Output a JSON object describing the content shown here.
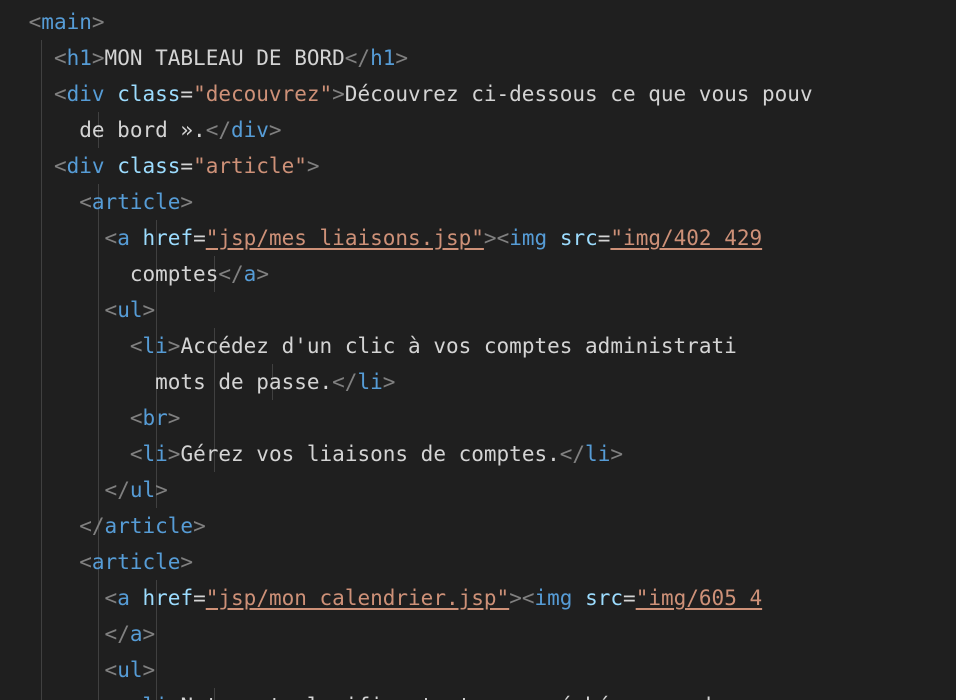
{
  "lines": [
    {
      "indent": 1,
      "tokens": [
        [
          "p",
          "<"
        ],
        [
          "tag",
          "main"
        ],
        [
          "p",
          ">"
        ]
      ]
    },
    {
      "indent": 3,
      "tokens": [
        [
          "p",
          "<"
        ],
        [
          "tag",
          "h1"
        ],
        [
          "p",
          ">"
        ],
        [
          "txt",
          "MON TABLEAU DE BORD"
        ],
        [
          "p",
          "</"
        ],
        [
          "tag",
          "h1"
        ],
        [
          "p",
          ">"
        ]
      ]
    },
    {
      "indent": 3,
      "tokens": [
        [
          "p",
          "<"
        ],
        [
          "tag",
          "div"
        ],
        [
          "txt",
          " "
        ],
        [
          "attr",
          "class"
        ],
        [
          "eq",
          "="
        ],
        [
          "str",
          "\"decouvrez\""
        ],
        [
          "p",
          ">"
        ],
        [
          "txt",
          "Découvrez ci-dessous ce que vous pouv"
        ]
      ]
    },
    {
      "indent": 5,
      "tokens": [
        [
          "txt",
          "de bord »."
        ],
        [
          "p",
          "</"
        ],
        [
          "tag",
          "div"
        ],
        [
          "p",
          ">"
        ]
      ]
    },
    {
      "indent": 3,
      "tokens": [
        [
          "p",
          "<"
        ],
        [
          "tag",
          "div"
        ],
        [
          "txt",
          " "
        ],
        [
          "attr",
          "class"
        ],
        [
          "eq",
          "="
        ],
        [
          "str",
          "\"article\""
        ],
        [
          "p",
          ">"
        ]
      ]
    },
    {
      "indent": 5,
      "tokens": [
        [
          "p",
          "<"
        ],
        [
          "tag",
          "article"
        ],
        [
          "p",
          ">"
        ]
      ]
    },
    {
      "indent": 7,
      "tokens": [
        [
          "p",
          "<"
        ],
        [
          "tag",
          "a"
        ],
        [
          "txt",
          " "
        ],
        [
          "attr",
          "href"
        ],
        [
          "eq",
          "="
        ],
        [
          "str link",
          "\"jsp/mes_liaisons.jsp\""
        ],
        [
          "p",
          ">"
        ],
        [
          "p",
          "<"
        ],
        [
          "tag",
          "img"
        ],
        [
          "txt",
          " "
        ],
        [
          "attr",
          "src"
        ],
        [
          "eq",
          "="
        ],
        [
          "str link",
          "\"img/402_429"
        ]
      ]
    },
    {
      "indent": 9,
      "tokens": [
        [
          "txt",
          "comptes"
        ],
        [
          "p",
          "</"
        ],
        [
          "tag",
          "a"
        ],
        [
          "p",
          ">"
        ]
      ]
    },
    {
      "indent": 7,
      "tokens": [
        [
          "p",
          "<"
        ],
        [
          "tag",
          "ul"
        ],
        [
          "p",
          ">"
        ]
      ]
    },
    {
      "indent": 9,
      "tokens": [
        [
          "p",
          "<"
        ],
        [
          "tag",
          "li"
        ],
        [
          "p",
          ">"
        ],
        [
          "txt",
          "Accédez d'un clic à vos comptes administrati"
        ]
      ]
    },
    {
      "indent": 11,
      "tokens": [
        [
          "txt",
          "mots de passe."
        ],
        [
          "p",
          "</"
        ],
        [
          "tag",
          "li"
        ],
        [
          "p",
          ">"
        ]
      ]
    },
    {
      "indent": 9,
      "tokens": [
        [
          "p",
          "<"
        ],
        [
          "tag",
          "br"
        ],
        [
          "p",
          ">"
        ]
      ]
    },
    {
      "indent": 9,
      "tokens": [
        [
          "p",
          "<"
        ],
        [
          "tag",
          "li"
        ],
        [
          "p",
          ">"
        ],
        [
          "txt",
          "Gérez vos liaisons de comptes."
        ],
        [
          "p",
          "</"
        ],
        [
          "tag",
          "li"
        ],
        [
          "p",
          ">"
        ]
      ]
    },
    {
      "indent": 7,
      "tokens": [
        [
          "p",
          "</"
        ],
        [
          "tag",
          "ul"
        ],
        [
          "p",
          ">"
        ]
      ]
    },
    {
      "indent": 5,
      "tokens": [
        [
          "p",
          "</"
        ],
        [
          "tag",
          "article"
        ],
        [
          "p",
          ">"
        ]
      ]
    },
    {
      "indent": 5,
      "tokens": [
        [
          "p",
          "<"
        ],
        [
          "tag",
          "article"
        ],
        [
          "p",
          ">"
        ]
      ]
    },
    {
      "indent": 7,
      "tokens": [
        [
          "p",
          "<"
        ],
        [
          "tag",
          "a"
        ],
        [
          "txt",
          " "
        ],
        [
          "attr",
          "href"
        ],
        [
          "eq",
          "="
        ],
        [
          "str link",
          "\"jsp/mon_calendrier.jsp\""
        ],
        [
          "p",
          ">"
        ],
        [
          "p",
          "<"
        ],
        [
          "tag",
          "img"
        ],
        [
          "txt",
          " "
        ],
        [
          "attr",
          "src"
        ],
        [
          "eq",
          "="
        ],
        [
          "str link",
          "\"img/605_4"
        ]
      ]
    },
    {
      "indent": 7,
      "tokens": [
        [
          "p",
          "</"
        ],
        [
          "tag",
          "a"
        ],
        [
          "p",
          ">"
        ]
      ]
    },
    {
      "indent": 7,
      "tokens": [
        [
          "p",
          "<"
        ],
        [
          "tag",
          "ul"
        ],
        [
          "p",
          ">"
        ]
      ]
    },
    {
      "indent": 9,
      "tokens": [
        [
          "p",
          "<"
        ],
        [
          "tag",
          "li"
        ],
        [
          "p",
          ">"
        ],
        [
          "txt",
          "Notez et planifiez toutes vos échéances ad"
        ]
      ]
    }
  ]
}
